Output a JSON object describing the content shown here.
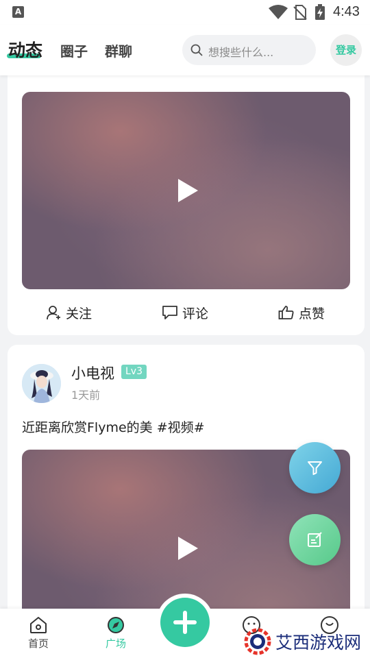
{
  "status_bar": {
    "time": "4:43",
    "icons": [
      "a-notification-icon",
      "wifi-icon",
      "no-sim-icon",
      "battery-charging-icon"
    ]
  },
  "header": {
    "tabs": [
      {
        "label": "动态",
        "active": true
      },
      {
        "label": "圈子",
        "active": false
      },
      {
        "label": "群聊",
        "active": false
      }
    ],
    "search_placeholder": "想搜些什么...",
    "login_label": "登录",
    "accent_color": "#35c9a1"
  },
  "feed": {
    "posts": [
      {
        "actions": {
          "follow": "关注",
          "comment": "评论",
          "like": "点赞"
        }
      },
      {
        "username": "小电视",
        "level": "Lv3",
        "time_ago": "1天前",
        "text": "近距离欣赏Flyme的美 #视频#"
      }
    ]
  },
  "fabs": {
    "filter_icon": "filter-icon",
    "edit_icon": "edit-icon"
  },
  "bottom_nav": {
    "items": [
      {
        "label": "首页",
        "icon": "home-icon"
      },
      {
        "label": "广场",
        "icon": "compass-icon",
        "active": true
      }
    ],
    "center_icon": "plus-icon"
  },
  "watermark": {
    "text": "艾西游戏网"
  }
}
